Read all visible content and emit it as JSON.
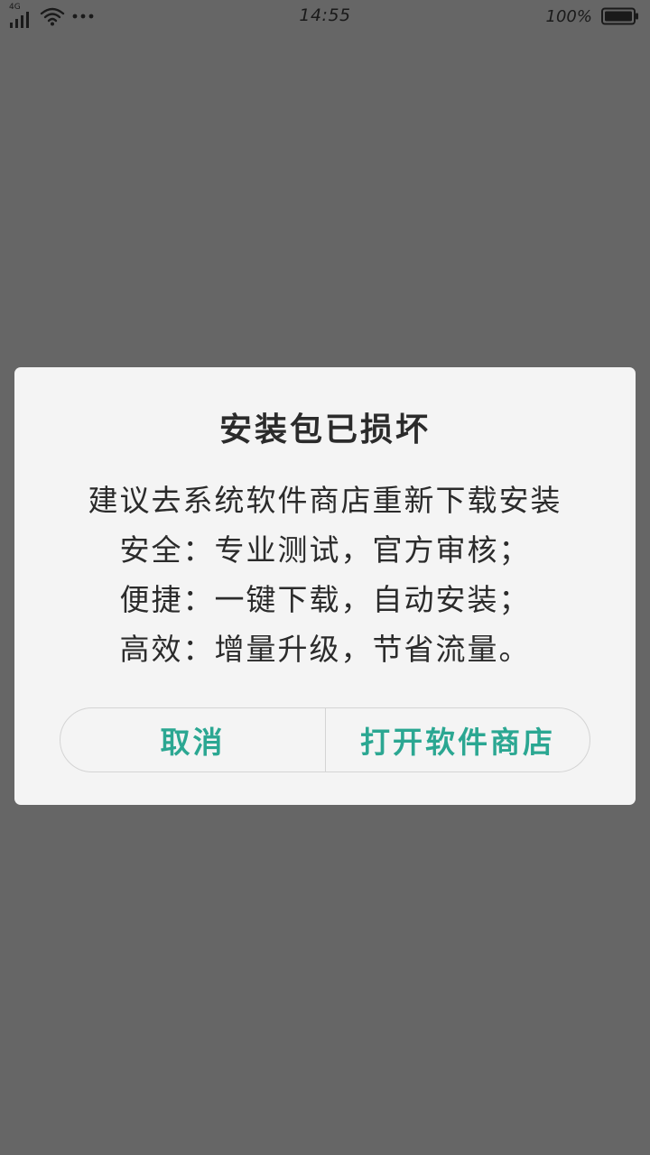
{
  "status_bar": {
    "network": "4G",
    "time": "14:55",
    "battery": "100%"
  },
  "dialog": {
    "title": "安装包已损坏",
    "lines": [
      "建议去系统软件商店重新下载安装",
      "安全：专业测试，官方审核；",
      "便捷：一键下载，自动安装；",
      "高效：增量升级，节省流量。"
    ],
    "buttons": {
      "cancel": "取消",
      "open_store": "打开软件商店"
    }
  },
  "colors": {
    "overlay": "#666666",
    "dialog_bg": "#f4f4f4",
    "accent": "#2ba792",
    "text": "#2b2b2b"
  }
}
